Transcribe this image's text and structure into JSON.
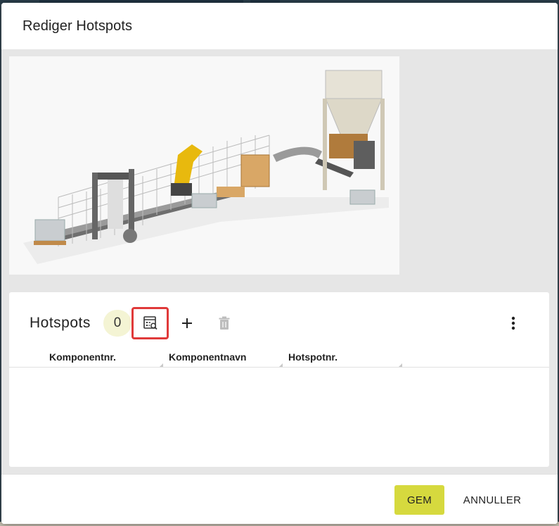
{
  "dialog": {
    "title": "Rediger Hotspots"
  },
  "image": {
    "description_icon": "factory-line-image"
  },
  "hotspots": {
    "title": "Hotspots",
    "count": "0",
    "icons": {
      "preview": "list-search-icon",
      "add": "plus-icon",
      "delete": "trash-icon",
      "more": "more-vertical-icon"
    },
    "columns": [
      "Komponentnr.",
      "Komponentnavn",
      "Hotspotnr."
    ],
    "rows": []
  },
  "footer": {
    "save_label": "GEM",
    "cancel_label": "ANNULLER"
  },
  "colors": {
    "accent": "#d6d93e",
    "badge_bg": "#f4f4d4",
    "highlight_border": "#e03a3a",
    "body_bg": "#e6e6e6"
  }
}
